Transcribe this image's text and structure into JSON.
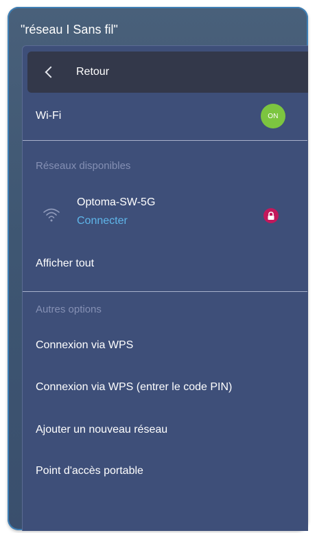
{
  "window": {
    "title": "\"réseau I Sans fil\""
  },
  "back": {
    "label": "Retour"
  },
  "wifi": {
    "label": "Wi-Fi",
    "toggle_text": "ON",
    "toggle_color": "#7cc540"
  },
  "available": {
    "section_label": "Réseaux disponibles",
    "networks": [
      {
        "name": "Optoma-SW-5G",
        "status": "Connecter",
        "icon": "wifi-icon",
        "secured": true,
        "lock_icon": "lock-icon"
      }
    ],
    "show_all": "Afficher tout"
  },
  "other": {
    "section_label": "Autres options",
    "items": [
      {
        "label": "Connexion via WPS"
      },
      {
        "label": "Connexion via WPS (entrer le code PIN)"
      },
      {
        "label": "Ajouter un nouveau réseau"
      },
      {
        "label": "Point d'accès portable"
      }
    ]
  },
  "colors": {
    "panel": "#3e4f79",
    "accent_link": "#5fb6ea",
    "lock_badge": "#c2185b",
    "section_label": "#8590b4"
  }
}
